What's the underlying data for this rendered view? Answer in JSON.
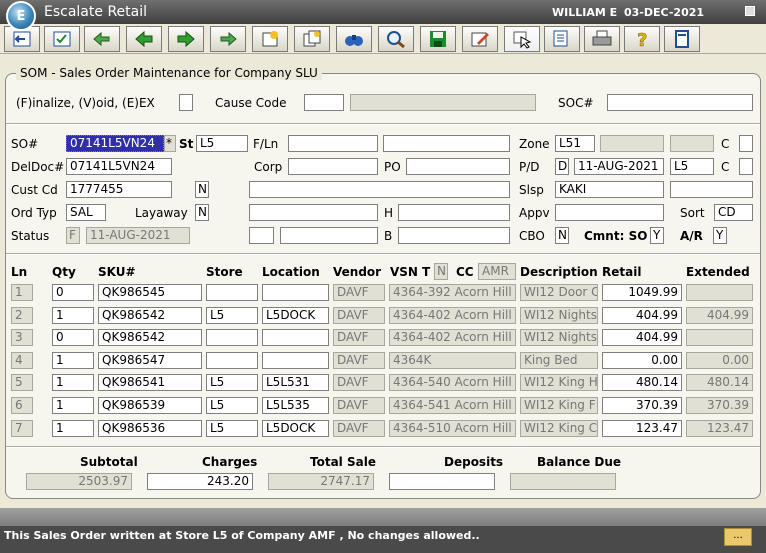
{
  "title_bar": {
    "app_title": "Escalate Retail",
    "user": "WILLIAM E",
    "date": "03-DEC-2021",
    "logo_glyph": "E"
  },
  "toolbar": {
    "buttons": [
      "exit-icon",
      "save-list-icon",
      "back-all-icon",
      "back-icon",
      "forward-icon",
      "forward-all-icon",
      "new-icon",
      "copy-icon",
      "binoculars-icon",
      "zoom-icon",
      "save-icon",
      "edit-icon",
      "pointer-icon",
      "notes-icon",
      "print-icon",
      "help-icon",
      "info-icon"
    ]
  },
  "panel": {
    "legend": "SOM - Sales Order Maintenance for Company SLU"
  },
  "action": {
    "label": "(F)inalize, (V)oid, (E)EX",
    "value": "",
    "cause_code_label": "Cause Code",
    "cause_code": "",
    "cause_desc": "",
    "soc_label": "SOC#",
    "soc": ""
  },
  "header": {
    "so_label": "SO#",
    "so": "07141L5VN24",
    "star": "*",
    "st_label": "St",
    "st": "L5",
    "fln_label": "F/Ln",
    "fln1": "",
    "fln2": "",
    "zone_label": "Zone",
    "zone": "L51",
    "zone_c_label": "C",
    "deldoc_label": "DelDoc#",
    "deldoc": "07141L5VN24",
    "corp_label": "Corp",
    "corp": "",
    "po_label": "PO",
    "po": "",
    "pd_label": "P/D",
    "pd": "D",
    "pd_date": "11-AUG-2021",
    "pd_store": "L5",
    "pd_c_label": "C",
    "cust_label": "Cust Cd",
    "cust": "1777455",
    "cust_flag": "N",
    "cust_name": "",
    "slsp_label": "Slsp",
    "slsp": "KAKI",
    "slsp2": "",
    "ordtyp_label": "Ord Typ",
    "ordtyp": "SAL",
    "layaway_label": "Layaway",
    "layaway": "N",
    "h_label": "H",
    "h": "",
    "appv_label": "Appv",
    "appv": "",
    "sort_label": "Sort",
    "sort": "CD",
    "status_label": "Status",
    "status": "F",
    "status_date": "11-AUG-2021",
    "b_label": "B",
    "b": "",
    "cbo_label": "CBO",
    "cbo": "N",
    "cmnt_label": "Cmnt: SO",
    "cmnt": "Y",
    "ar_label": "A/R",
    "ar": "Y"
  },
  "lines": {
    "columns": {
      "ln": "Ln",
      "qty": "Qty",
      "sku": "SKU#",
      "store": "Store",
      "location": "Location",
      "vendor": "Vendor",
      "vsn": "VSN",
      "t": "T",
      "t_value": "N",
      "cc": "CC",
      "cc_value": "AMR",
      "description": "Description",
      "retail": "Retail",
      "extended": "Extended"
    },
    "rows": [
      {
        "ln": "1",
        "qty": "0",
        "sku": "QK986545",
        "store": "",
        "location": "",
        "vendor": "DAVF",
        "vsn": "4364-392 Acorn Hill",
        "desc": "WI12 Door C",
        "retail": "1049.99",
        "extended": ""
      },
      {
        "ln": "2",
        "qty": "1",
        "sku": "QK986542",
        "store": "L5",
        "location": "L5DOCK",
        "vendor": "DAVF",
        "vsn": "4364-402 Acorn Hill",
        "desc": "WI12 Nights",
        "retail": "404.99",
        "extended": "404.99"
      },
      {
        "ln": "3",
        "qty": "0",
        "sku": "QK986542",
        "store": "",
        "location": "",
        "vendor": "DAVF",
        "vsn": "4364-402 Acorn Hill",
        "desc": "WI12 Nights",
        "retail": "404.99",
        "extended": ""
      },
      {
        "ln": "4",
        "qty": "1",
        "sku": "QK986547",
        "store": "",
        "location": "",
        "vendor": "DAVF",
        "vsn": "4364K",
        "desc": "King Bed",
        "retail": "0.00",
        "extended": "0.00"
      },
      {
        "ln": "5",
        "qty": "1",
        "sku": "QK986541",
        "store": "L5",
        "location": "L5L531",
        "vendor": "DAVF",
        "vsn": "4364-540 Acorn Hill",
        "desc": "WI12 King H",
        "retail": "480.14",
        "extended": "480.14"
      },
      {
        "ln": "6",
        "qty": "1",
        "sku": "QK986539",
        "store": "L5",
        "location": "L5L535",
        "vendor": "DAVF",
        "vsn": "4364-541 Acorn Hill",
        "desc": "WI12 King F",
        "retail": "370.39",
        "extended": "370.39"
      },
      {
        "ln": "7",
        "qty": "1",
        "sku": "QK986536",
        "store": "L5",
        "location": "L5DOCK",
        "vendor": "DAVF",
        "vsn": "4364-510 Acorn Hill",
        "desc": "WI12 King C",
        "retail": "123.47",
        "extended": "123.47"
      }
    ]
  },
  "totals": {
    "subtotal_label": "Subtotal",
    "subtotal": "2503.97",
    "charges_label": "Charges",
    "charges": "243.20",
    "total_label": "Total Sale",
    "total": "2747.17",
    "deposits_label": "Deposits",
    "deposits": "",
    "balance_label": "Balance Due",
    "balance": ""
  },
  "message": {
    "text": "This Sales Order written at Store  L5  of Company  AMF , No changes allowed..",
    "button": "..."
  }
}
